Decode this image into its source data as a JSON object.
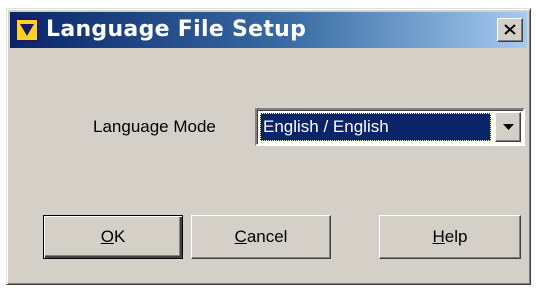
{
  "window": {
    "title": "Language File Setup",
    "icon": "app-v-icon",
    "close_icon": "close-icon"
  },
  "form": {
    "language_mode_label": "Language Mode",
    "language_mode_value": "English / English",
    "dropdown_icon": "chevron-down-icon"
  },
  "buttons": {
    "ok": {
      "mnemonic": "O",
      "rest": "K"
    },
    "cancel": {
      "mnemonic": "C",
      "rest": "ancel"
    },
    "help": {
      "mnemonic": "H",
      "rest": "elp"
    }
  },
  "colors": {
    "title_start": "#0a246a",
    "title_end": "#a6caf0",
    "face": "#d4d0c8",
    "selection": "#0a246a",
    "icon_fill": "#ffd21f"
  }
}
